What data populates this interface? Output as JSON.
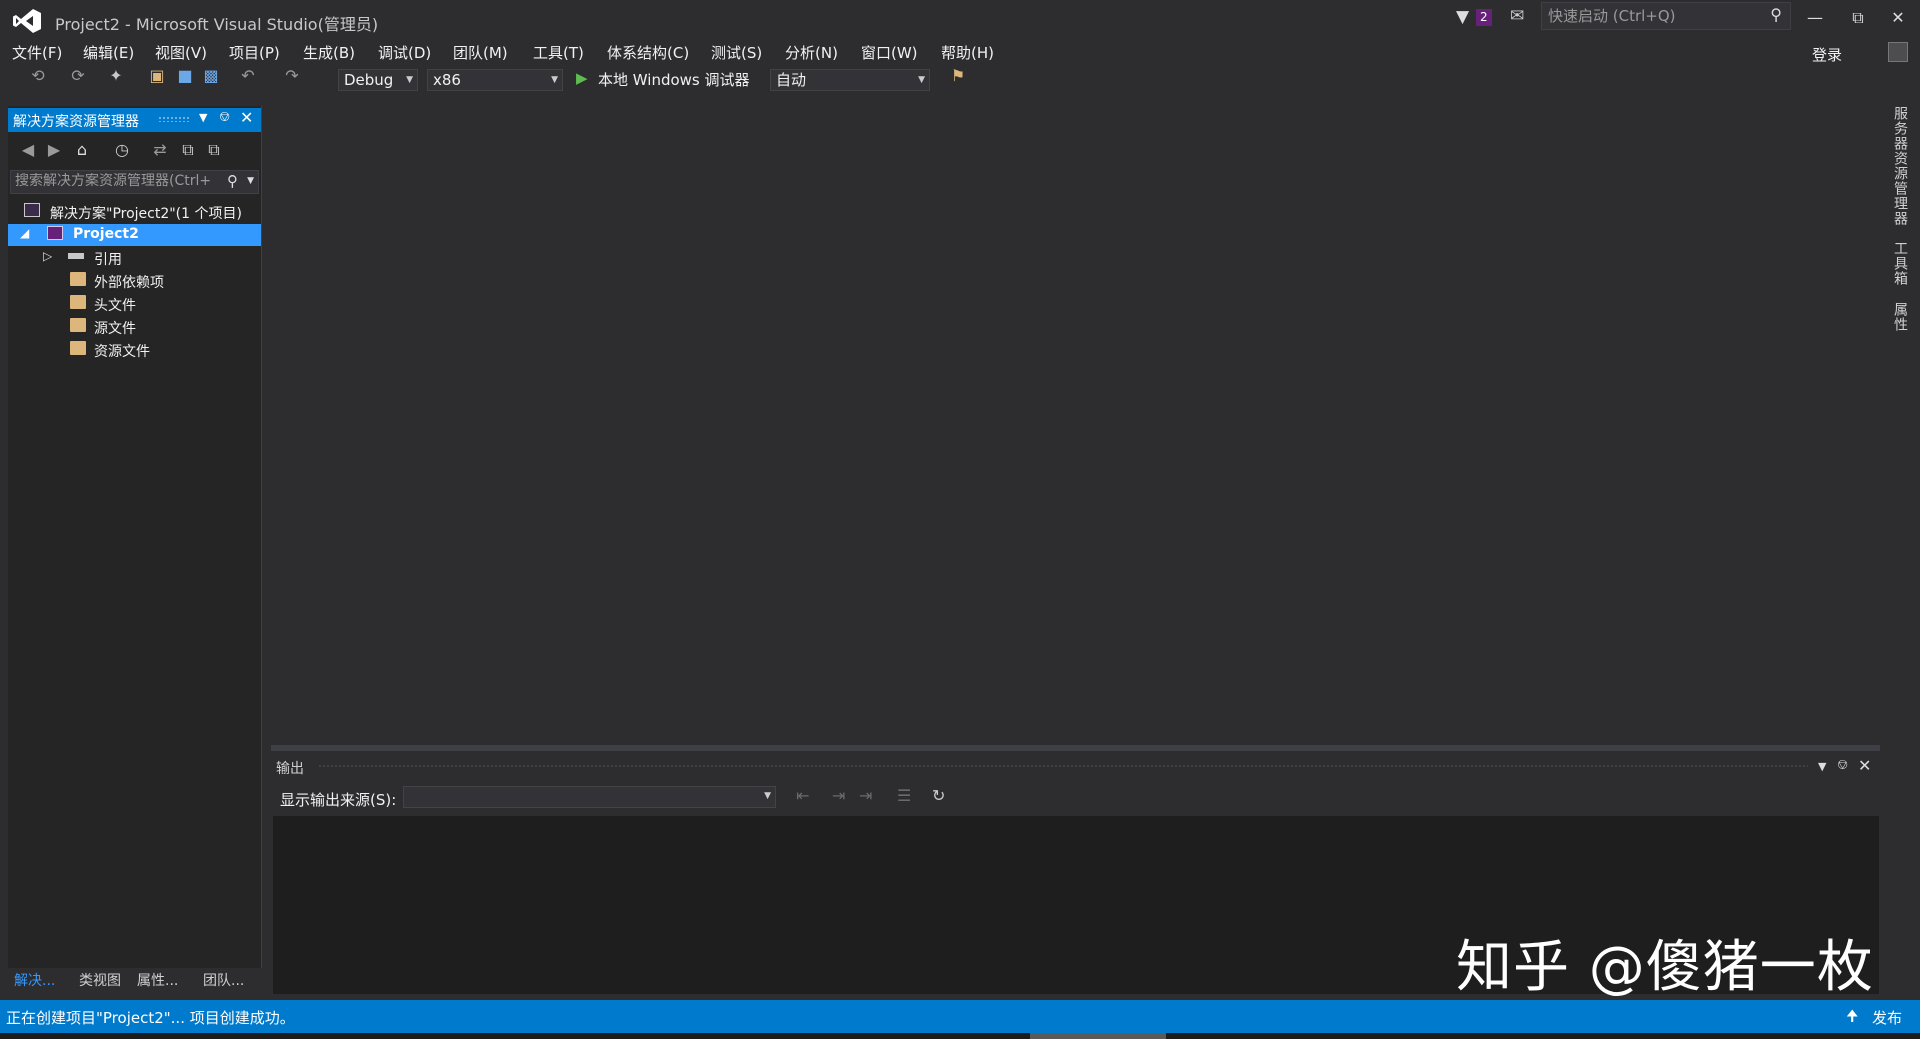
{
  "window": {
    "title": "Project2 - Microsoft Visual Studio(管理员)",
    "notification_count": "2",
    "quick_launch_placeholder": "快速启动 (Ctrl+Q)",
    "sign_in": "登录"
  },
  "menu": [
    "文件(F)",
    "编辑(E)",
    "视图(V)",
    "项目(P)",
    "生成(B)",
    "调试(D)",
    "团队(M)",
    "工具(T)",
    "体系结构(C)",
    "测试(S)",
    "分析(N)",
    "窗口(W)",
    "帮助(H)"
  ],
  "toolbar": {
    "configuration": "Debug",
    "platform": "x86",
    "debugger_label": "本地 Windows 调试器",
    "auto_label": "自动"
  },
  "solution_explorer": {
    "title": "解决方案资源管理器",
    "search_placeholder": "搜索解决方案资源管理器(Ctrl+",
    "tree": [
      {
        "label": "解决方案\"Project2\"(1 个项目)",
        "icon": "solution-icon"
      },
      {
        "label": "Project2",
        "icon": "project-icon",
        "selected": true
      },
      {
        "label": "引用",
        "icon": "references-icon"
      },
      {
        "label": "外部依赖项",
        "icon": "external-deps-icon"
      },
      {
        "label": "头文件",
        "icon": "folder-icon"
      },
      {
        "label": "源文件",
        "icon": "folder-icon"
      },
      {
        "label": "资源文件",
        "icon": "folder-icon"
      }
    ],
    "tabs": [
      "解决...",
      "类视图",
      "属性...",
      "团队..."
    ]
  },
  "output": {
    "title": "输出",
    "source_label": "显示输出来源(S):",
    "source_value": ""
  },
  "right_dock": {
    "tabs": [
      "服务器资源管理器",
      "工具箱",
      "属性"
    ]
  },
  "watermark": "知乎 @傻猪一枚",
  "status": {
    "message": "正在创建项目\"Project2\"... 项目创建成功。",
    "publish": "发布"
  },
  "colors": {
    "accent": "#007acc",
    "selection": "#3399ff",
    "background": "#2d2d30",
    "panel": "#252526",
    "logo_purple": "#68217a"
  }
}
